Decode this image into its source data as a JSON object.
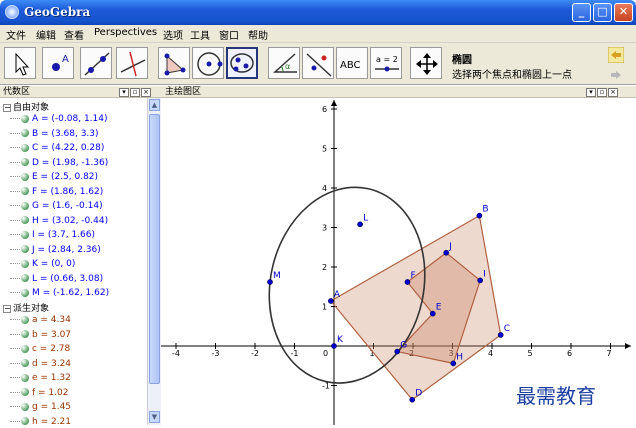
{
  "window": {
    "title": "GeoGebra"
  },
  "menu": [
    "文件",
    "编辑",
    "查看",
    "Perspectives",
    "选项",
    "工具",
    "窗口",
    "帮助"
  ],
  "toolbar": {
    "active_tool_name": "椭圆",
    "active_tool_help": "选择两个焦点和椭圆上一点",
    "tools": [
      "move",
      "point",
      "line",
      "perpendicular-line",
      "polygon",
      "circle",
      "ellipse",
      "angle",
      "reflect",
      "text",
      "slider",
      "move-graphics-view"
    ],
    "text_tool_label": "ABC",
    "slider_tool_label": "a = 2"
  },
  "algebra_view": {
    "title": "代数区",
    "free_group_label": "自由对象",
    "dependent_group_label": "派生对象",
    "free_objects": [
      "A = (-0.08, 1.14)",
      "B = (3.68, 3.3)",
      "C = (4.22, 0.28)",
      "D = (1.98, -1.36)",
      "E = (2.5, 0.82)",
      "F = (1.86, 1.62)",
      "G = (1.6, -0.14)",
      "H = (3.02, -0.44)",
      "I = (3.7, 1.66)",
      "J = (2.84, 2.36)",
      "K = (0, 0)",
      "L = (0.66, 3.08)",
      "M = (-1.62, 1.62)"
    ],
    "dependent_objects": [
      "a = 4.34",
      "b = 3.07",
      "c = 2.78",
      "d = 3.24",
      "e = 1.32",
      "f = 1.02",
      "g = 1.45",
      "h = 2.21"
    ]
  },
  "graphics_view": {
    "title": "主绘图区",
    "x_ticks": [
      "-4",
      "-3",
      "-2",
      "-1",
      "0",
      "1",
      "2",
      "3",
      "4",
      "5",
      "6",
      "7"
    ],
    "y_ticks": [
      "6",
      "5",
      "4",
      "3",
      "2",
      "1",
      "-1"
    ],
    "points": [
      {
        "label": "A",
        "x": -0.08,
        "y": 1.14
      },
      {
        "label": "B",
        "x": 3.68,
        "y": 3.3
      },
      {
        "label": "C",
        "x": 4.22,
        "y": 0.28
      },
      {
        "label": "D",
        "x": 1.98,
        "y": -1.36
      },
      {
        "label": "E",
        "x": 2.5,
        "y": 0.82
      },
      {
        "label": "F",
        "x": 1.86,
        "y": 1.62
      },
      {
        "label": "G",
        "x": 1.6,
        "y": -0.14
      },
      {
        "label": "H",
        "x": 3.02,
        "y": -0.44
      },
      {
        "label": "I",
        "x": 3.7,
        "y": 1.66
      },
      {
        "label": "J",
        "x": 2.84,
        "y": 2.36
      },
      {
        "label": "K",
        "x": 0,
        "y": 0
      },
      {
        "label": "L",
        "x": 0.66,
        "y": 3.08
      },
      {
        "label": "M",
        "x": -1.62,
        "y": 1.62
      }
    ],
    "outer_polygon": [
      "A",
      "B",
      "C",
      "D"
    ],
    "inner_polygon": [
      "E",
      "F",
      "J",
      "I",
      "H",
      "G"
    ],
    "ellipse": {
      "foci": [
        "K",
        "L"
      ],
      "through": "M"
    },
    "colors": {
      "point": "#0000cc",
      "polygon_fill": "#c0705066",
      "polygon_stroke": "#b06040",
      "ellipse": "#333333",
      "axis": "#000000"
    }
  },
  "watermark": "最需教育"
}
